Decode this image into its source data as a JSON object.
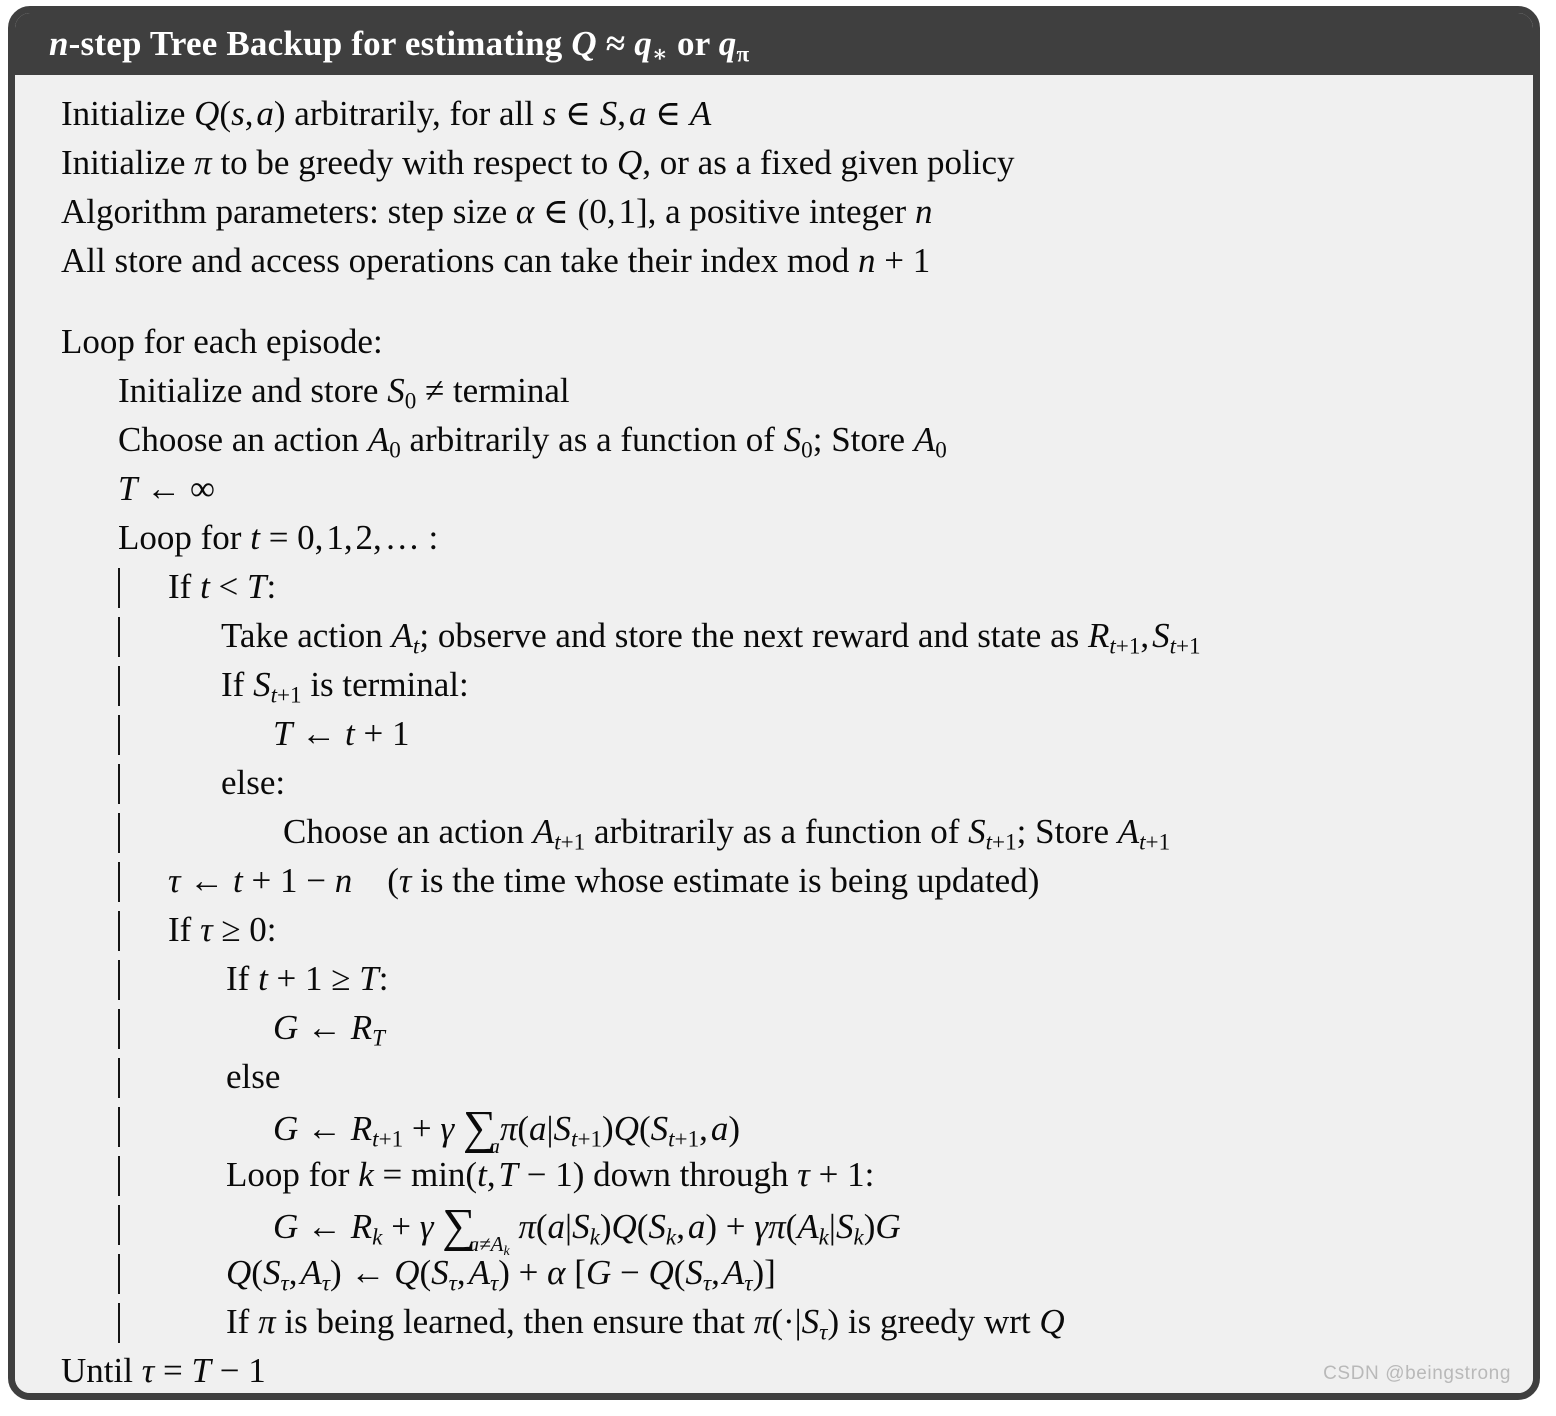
{
  "card": {
    "header_title_plain": "n-step Tree Backup for estimating Q ≈ q* or qπ",
    "border_color": "#3f3f3f",
    "header_bg": "#3f3f3f",
    "header_text_color": "#ffffff",
    "body_bg": "#f0f0f0",
    "text_color": "#0a0a0a"
  },
  "watermark": "CSDN @beingstrong",
  "algorithm": {
    "title": "n-step Tree Backup for estimating Q ≈ q* or qπ",
    "init_block": [
      "Initialize Q(s, a) arbitrarily, for all s ∈ S, a ∈ A",
      "Initialize π to be greedy with respect to Q, or as a fixed given policy",
      "Algorithm parameters: step size α ∈ (0, 1], a positive integer n",
      "All store and access operations can take their index mod n + 1"
    ],
    "body_lines": [
      {
        "indent": 0,
        "bar": false,
        "text": "Loop for each episode:"
      },
      {
        "indent": 1,
        "bar": false,
        "text": "Initialize and store S₀ ≠ terminal"
      },
      {
        "indent": 1,
        "bar": false,
        "text": "Choose an action A₀ arbitrarily as a function of S₀; Store A₀"
      },
      {
        "indent": 1,
        "bar": false,
        "text": "T ← ∞"
      },
      {
        "indent": 1,
        "bar": false,
        "text": "Loop for t = 0, 1, 2, … :"
      },
      {
        "indent": 2,
        "bar": true,
        "text": "If t < T:"
      },
      {
        "indent": 3,
        "bar": true,
        "text": "Take action Aₜ; observe and store the next reward and state as R₍t+1₎, S₍t+1₎"
      },
      {
        "indent": 3,
        "bar": true,
        "text": "If S₍t+1₎ is terminal:"
      },
      {
        "indent": 4,
        "bar": true,
        "text": "T ← t + 1"
      },
      {
        "indent": 3,
        "bar": true,
        "text": "else:"
      },
      {
        "indent": 4,
        "bar": true,
        "text": "Choose an action A₍t+1₎ arbitrarily as a function of S₍t+1₎; Store A₍t+1₎"
      },
      {
        "indent": 2,
        "bar": true,
        "text": "τ ← t + 1 − n    (τ is the time whose estimate is being updated)"
      },
      {
        "indent": 2,
        "bar": true,
        "text": "If τ ≥ 0:"
      },
      {
        "indent": 3,
        "bar": true,
        "text": "If t + 1 ≥ T:"
      },
      {
        "indent": 4,
        "bar": true,
        "text": "G ← R_T"
      },
      {
        "indent": 3,
        "bar": true,
        "text": "else"
      },
      {
        "indent": 4,
        "bar": true,
        "text": "G ← R₍t+1₎ + γ Σₐ π(a|S₍t+1₎)Q(S₍t+1₎, a)"
      },
      {
        "indent": 3,
        "bar": true,
        "text": "Loop for k = min(t, T − 1) down through τ + 1:"
      },
      {
        "indent": 4,
        "bar": true,
        "text": "G ← R_k + γ Σ_{a≠A_k} π(a|S_k)Q(S_k, a) + γπ(A_k|S_k)G"
      },
      {
        "indent": 3,
        "bar": true,
        "text": "Q(S_τ, A_τ) ← Q(S_τ, A_τ) + α [G − Q(S_τ, A_τ)]"
      },
      {
        "indent": 3,
        "bar": true,
        "text": "If π is being learned, then ensure that π(·|S_τ) is greedy wrt Q"
      },
      {
        "indent": 0,
        "bar": false,
        "text": "Until τ = T − 1"
      }
    ]
  }
}
